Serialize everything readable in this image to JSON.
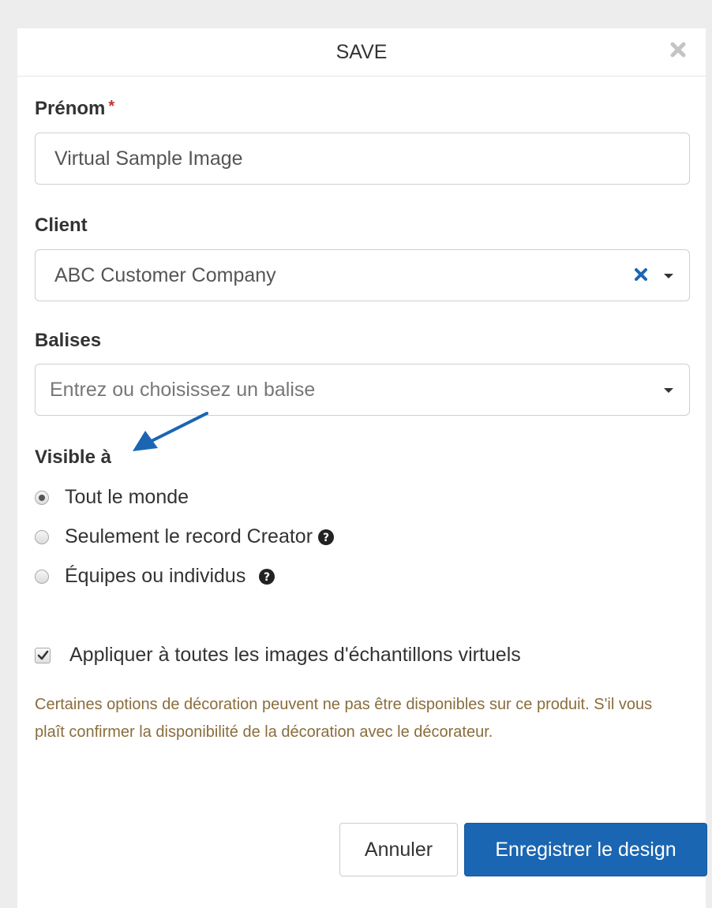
{
  "modal": {
    "title": "SAVE",
    "close_icon": "close-icon"
  },
  "form": {
    "prenom": {
      "label": "Prénom",
      "required_mark": "*",
      "value": "Virtual Sample Image"
    },
    "client": {
      "label": "Client",
      "value": "ABC Customer Company",
      "clear_icon": "clear-x-icon",
      "caret_icon": "chevron-down-icon"
    },
    "balises": {
      "label": "Balises",
      "placeholder": "Entrez ou choisissez un balise",
      "caret_icon": "chevron-down-icon"
    },
    "visibility": {
      "label": "Visible à",
      "options": [
        {
          "label": "Tout le monde",
          "checked": true
        },
        {
          "label": "Seulement le record Creator",
          "checked": false,
          "help_icon": "question-circle-icon"
        },
        {
          "label": "Équipes ou individus",
          "checked": false,
          "help_icon": "question-circle-icon"
        }
      ]
    },
    "apply_all": {
      "label": "Appliquer à toutes les images d'échantillons virtuels",
      "checked": true
    },
    "note": "Certaines options de décoration peuvent ne pas être disponibles sur ce produit. S'il vous plaît confirmer la disponibilité de la décoration avec le décorateur."
  },
  "footer": {
    "cancel_label": "Annuler",
    "save_label": "Enregistrer le design"
  },
  "colors": {
    "primary": "#1a66b2",
    "required": "#c9302c",
    "note_text": "#8a6d3b",
    "arrow": "#1a66b2"
  }
}
